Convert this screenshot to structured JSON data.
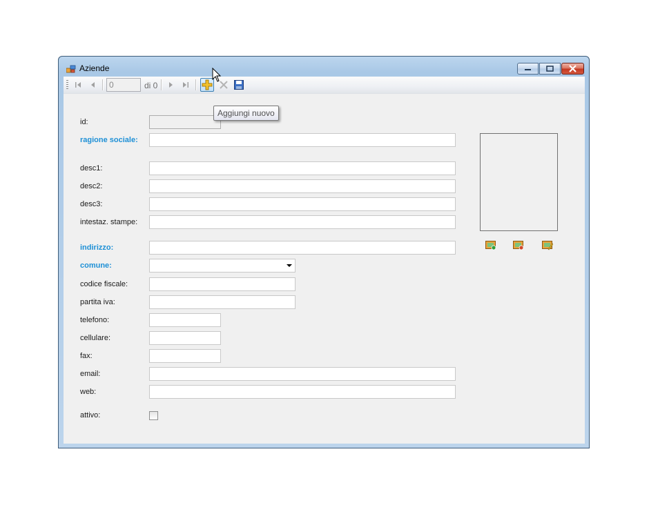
{
  "window": {
    "title": "Aziende"
  },
  "navigator": {
    "position_value": "0",
    "count_label": "di 0",
    "first_label": "",
    "add_tooltip": "Aggiungi nuovo"
  },
  "form": {
    "id": "id:",
    "ragione_sociale": "ragione sociale:",
    "desc1": "desc1:",
    "desc2": "desc2:",
    "desc3": "desc3:",
    "intestaz": "intestaz. stampe:",
    "indirizzo": "indirizzo:",
    "comune": "comune:",
    "codice_fiscale": "codice fiscale:",
    "partita_iva": "partita iva:",
    "telefono": "telefono:",
    "cellulare": "cellulare:",
    "fax": "fax:",
    "email": "email:",
    "web": "web:",
    "attivo": "attivo:"
  },
  "colors": {
    "required_label": "#1e90d6",
    "accent": "#3c7fb1"
  },
  "icons": [
    "app-icon",
    "move-first-icon",
    "move-previous-icon",
    "move-next-icon",
    "move-last-icon",
    "add-icon",
    "delete-icon",
    "save-icon",
    "add-image-icon",
    "remove-image-icon",
    "edit-image-icon",
    "mouse-cursor-icon"
  ]
}
